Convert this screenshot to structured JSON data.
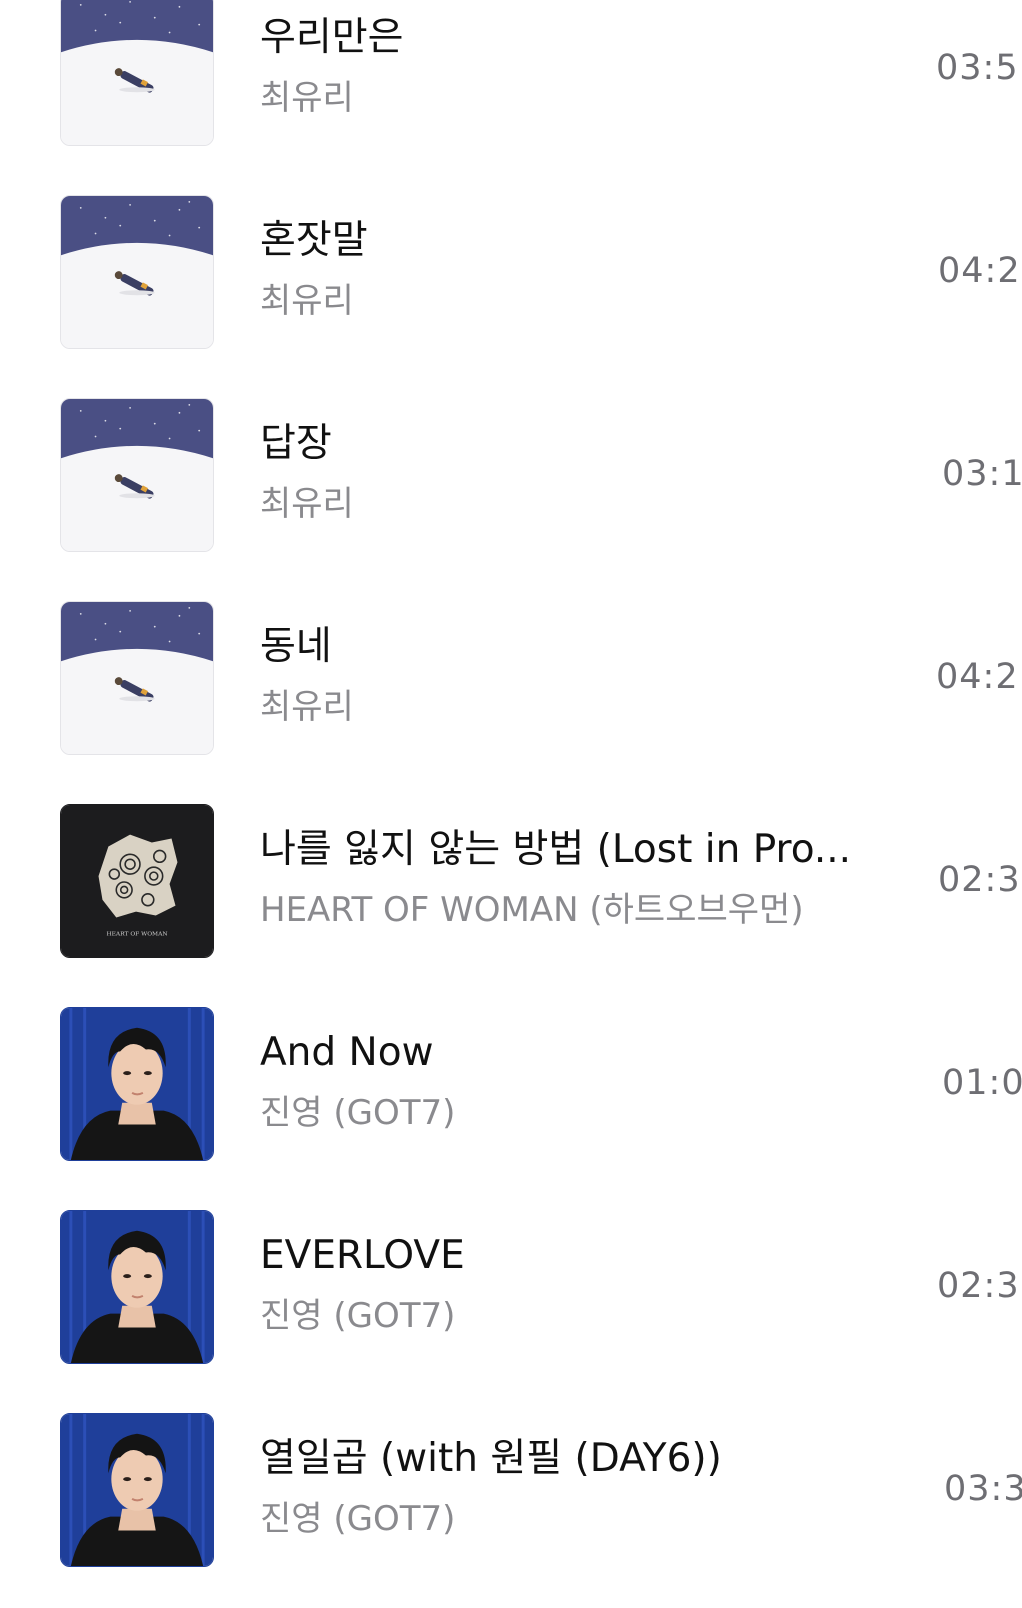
{
  "tracks": [
    {
      "title": "우리만은",
      "artist": "최유리",
      "duration": "03:5",
      "cover": "night-sky-cover"
    },
    {
      "title": "혼잣말",
      "artist": "최유리",
      "duration": "04:2",
      "cover": "night-sky-cover"
    },
    {
      "title": "답장",
      "artist": "최유리",
      "duration": "03:1",
      "cover": "night-sky-cover"
    },
    {
      "title": "동네",
      "artist": "최유리",
      "duration": "04:2",
      "cover": "night-sky-cover"
    },
    {
      "title": "나를 잃지 않는 방법 (Lost in Pro...",
      "artist": "HEART OF WOMAN (하트오브우먼)",
      "duration": "02:3",
      "cover": "dark-collage-cover",
      "cover_text": "HEART OF WOMAN"
    },
    {
      "title": "And Now",
      "artist": "진영 (GOT7)",
      "duration": "01:0",
      "cover": "portrait-cover"
    },
    {
      "title": "EVERLOVE",
      "artist": "진영 (GOT7)",
      "duration": "02:3",
      "cover": "portrait-cover"
    },
    {
      "title": "열일곱 (with 원필 (DAY6))",
      "artist": "진영 (GOT7)",
      "duration": "03:3",
      "cover": "portrait-cover"
    }
  ],
  "colors": {
    "title": "#111111",
    "artist": "#8a8a8e",
    "duration": "#6e6e73",
    "night_sky": "#4a4f84",
    "dark_cover": "#1c1c1e",
    "portrait_bg": "#1f3f9a"
  }
}
